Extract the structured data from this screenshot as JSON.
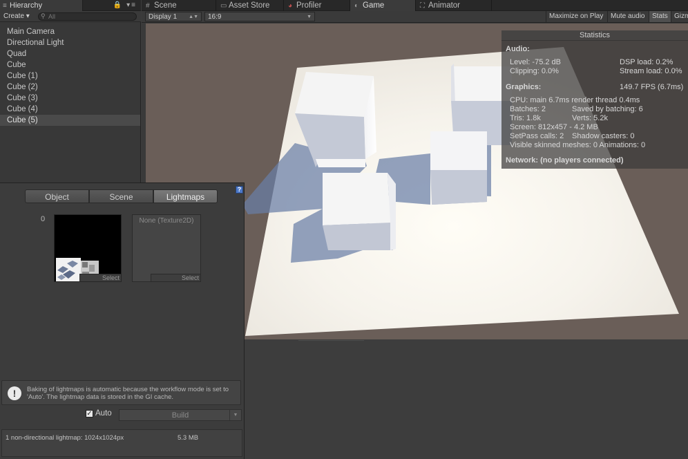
{
  "hierarchy": {
    "tab_label": "Hierarchy",
    "tab_controls": "🔒 ▾≡",
    "create_label": "Create ▾",
    "search_placeholder": "All",
    "items": [
      {
        "label": "Main Camera"
      },
      {
        "label": "Directional Light"
      },
      {
        "label": "Quad"
      },
      {
        "label": "Cube"
      },
      {
        "label": "Cube (1)"
      },
      {
        "label": "Cube (2)"
      },
      {
        "label": "Cube (3)"
      },
      {
        "label": "Cube (4)"
      },
      {
        "label": "Cube (5)",
        "selected": true
      }
    ]
  },
  "tabs": {
    "scene": "Scene",
    "asset_store": "Asset Store",
    "profiler": "Profiler",
    "game": "Game",
    "animator": "Animator"
  },
  "gamebar": {
    "display": "Display 1",
    "aspect": "16:9",
    "maximize": "Maximize on Play",
    "mute": "Mute audio",
    "stats": "Stats",
    "gizmos": "Gizm"
  },
  "stats": {
    "title": "Statistics",
    "audio_header": "Audio:",
    "level": "Level: -75.2 dB",
    "dsp": "DSP load: 0.2%",
    "clipping": "Clipping: 0.0%",
    "stream": "Stream load: 0.0%",
    "graphics_header": "Graphics:",
    "fps": "149.7 FPS (6.7ms)",
    "cpu": "CPU: main 6.7ms  render thread 0.4ms",
    "batches": "Batches: 2",
    "saved": "Saved by batching: 6",
    "tris": "Tris: 1.8k",
    "verts": "Verts: 5.2k",
    "screen": "Screen: 812x457 - 4.2 MB",
    "setpass": "SetPass calls: 2",
    "shadow": "Shadow casters: 0",
    "skinned": "Visible skinned meshes: 0  Animations: 0",
    "network": "Network: (no players connected)"
  },
  "lighting": {
    "tabs": [
      "Object",
      "Scene",
      "Lightmaps"
    ],
    "active_tab": "Lightmaps",
    "help": "?",
    "index": "0",
    "select_label": "Select",
    "empty_slot": "None (Texture2D)",
    "empty_select": "Select",
    "info_text": "Baking of lightmaps is automatic because the workflow mode is set to 'Auto'. The lightmap data is stored in the GI cache.",
    "auto_label": "Auto",
    "auto_checked": true,
    "build_label": "Build",
    "summary_left": "1 non-directional lightmap: 1024x1024px",
    "summary_right": "5.3 MB"
  }
}
